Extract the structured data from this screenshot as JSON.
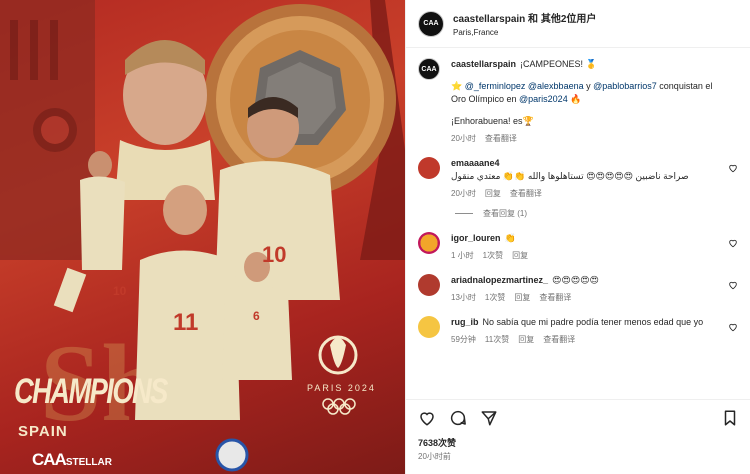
{
  "poster": {
    "title": "CHAMPIONS",
    "subtitle": "SPAIN",
    "brand_main": "CAA",
    "brand_sub": "STELLAR",
    "event": "PARIS 2024",
    "number_left": "10",
    "number_center": "11",
    "number_right": "10",
    "number_small": "6"
  },
  "header": {
    "title": "caastellarspain 和 其他2位用户",
    "location": "Paris,France",
    "avatar_text": "CAA"
  },
  "caption": {
    "user": "caastellarspain",
    "headline": "¡CAMPEONES! 🥇",
    "line_prefix": "⭐ ",
    "mention1": "@_ferminlopez",
    "mention2": "@alexbbaena",
    "y": " y ",
    "mention3": "@pablobarrios7",
    "line_mid": " conquistan el Oro Olímpico en ",
    "mention4": "@paris2024",
    "line_end": " 🔥",
    "congrats": "¡Enhorabuena! es🏆",
    "time": "20小时",
    "translate": "查看翻译"
  },
  "comments": [
    {
      "user": "emaaaane4",
      "text": "صراحة ناضبين 😍😍😍😍😍 تستاهلوها والله 👏👏 معتدي منقول",
      "time": "20小时",
      "reply": "回复",
      "translate": "查看翻译"
    },
    {
      "user": "igor_louren",
      "text": "👏",
      "time": "1 小时",
      "likes": "1次赞",
      "reply": "回复"
    },
    {
      "user": "ariadnalopezmartinez_",
      "text": "😍😍😍😍😍",
      "time": "13小时",
      "likes": "1次赞",
      "reply": "回复",
      "translate": "查看翻译"
    },
    {
      "user": "rug_ib",
      "text": "No sabía que mi padre podía tener menos edad que yo",
      "time": "59分钟",
      "likes": "11次赞",
      "reply": "回复",
      "translate": "查看翻译"
    }
  ],
  "view_replies": "查看回复 (1)",
  "likes": "7638次赞",
  "posted": "20小时前",
  "colors": {
    "accent": "#c9402a",
    "muted": "#737373",
    "link": "#00376b",
    "cream": "#f6e9c9"
  }
}
